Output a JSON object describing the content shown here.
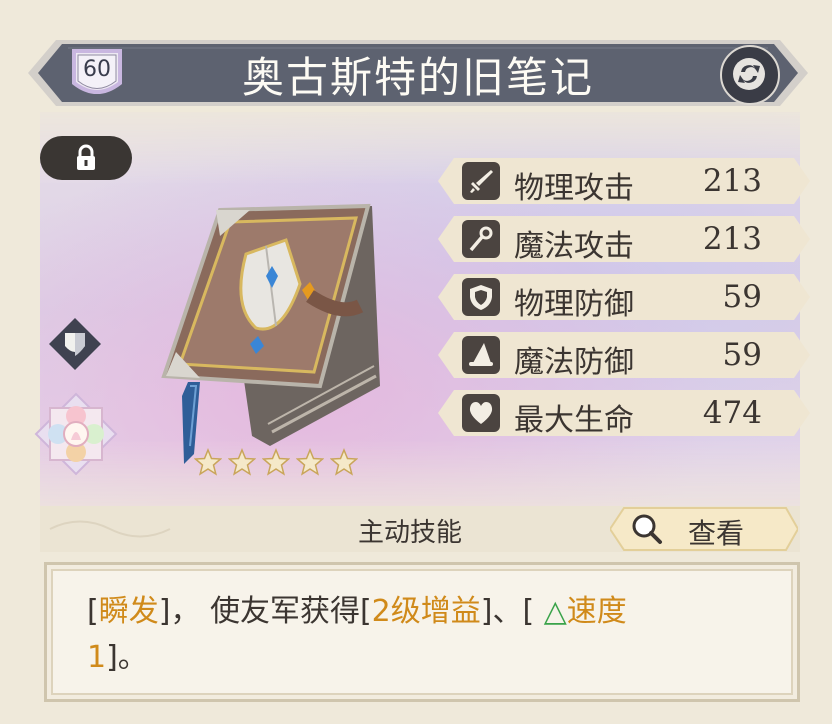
{
  "header": {
    "title": "奥古斯特的旧笔记",
    "level": "60"
  },
  "stars": 5,
  "stats": [
    {
      "label": "物理攻击",
      "value": "213",
      "icon": "sword-icon"
    },
    {
      "label": "魔法攻击",
      "value": "213",
      "icon": "staff-icon"
    },
    {
      "label": "物理防御",
      "value": "59",
      "icon": "shield-icon"
    },
    {
      "label": "魔法防御",
      "value": "59",
      "icon": "wizard-hat-icon"
    },
    {
      "label": "最大生命",
      "value": "474",
      "icon": "heart-icon"
    }
  ],
  "skill": {
    "title": "主动技能",
    "view_label": "查看"
  },
  "description": {
    "p1": "[",
    "t1": "瞬发",
    "p2": "]， 使友军获得[",
    "t2": "2级增益",
    "p3": "]、[ ",
    "tri": "△",
    "t3": "速度",
    "t4": "1",
    "p4": "]。"
  },
  "colors": {
    "highlight": "#d08a1a",
    "buff_triangle": "#3aa34a",
    "banner": "#5d6270"
  }
}
